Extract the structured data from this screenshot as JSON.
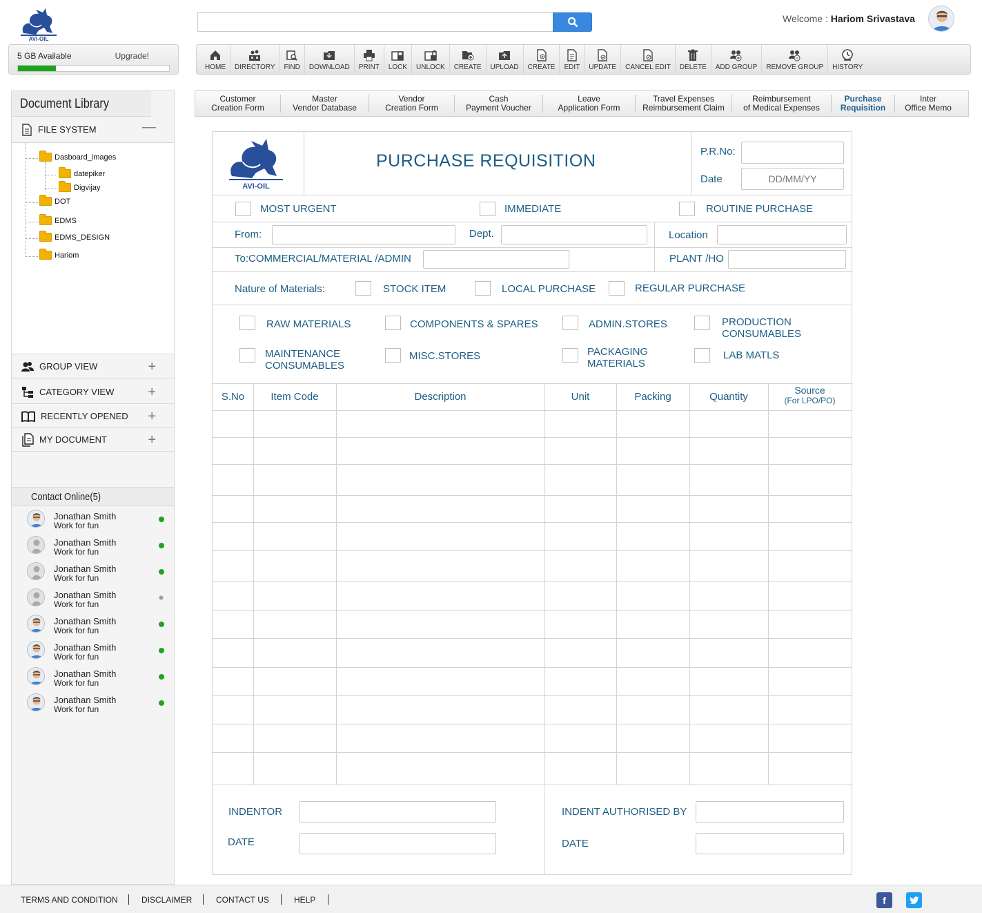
{
  "header": {
    "brand": "AVI-OIL",
    "search": {
      "placeholder": "",
      "value": ""
    },
    "welcome_prefix": "Welcome : ",
    "user_name": "Hariom Srivastava"
  },
  "storage": {
    "available": "5 GB Available",
    "upgrade": "Upgrade!",
    "used_fraction": 0.25
  },
  "toolbar": [
    {
      "label": "HOME",
      "icon": "home-icon"
    },
    {
      "label": "DIRECTORY",
      "icon": "directory-icon"
    },
    {
      "label": "FIND",
      "icon": "find-icon"
    },
    {
      "label": "DOWNLOAD",
      "icon": "download-icon"
    },
    {
      "label": "PRINT",
      "icon": "print-icon"
    },
    {
      "label": "LOCK",
      "icon": "lock-icon"
    },
    {
      "label": "UNLOCK",
      "icon": "unlock-icon"
    },
    {
      "label": "CREATE",
      "icon": "create-folder-icon"
    },
    {
      "label": "UPLOAD",
      "icon": "upload-icon"
    },
    {
      "label": "CREATE",
      "icon": "create-document-icon"
    },
    {
      "label": "EDIT",
      "icon": "edit-icon"
    },
    {
      "label": "UPDATE",
      "icon": "update-icon"
    },
    {
      "label": "CANCEL EDIT",
      "icon": "cancel-edit-icon"
    },
    {
      "label": "DELETE",
      "icon": "delete-icon"
    },
    {
      "label": "ADD GROUP",
      "icon": "add-group-icon"
    },
    {
      "label": "REMOVE GROUP",
      "icon": "remove-group-icon"
    },
    {
      "label": "HISTORY",
      "icon": "history-icon"
    }
  ],
  "sidebar": {
    "title": "Document Library",
    "file_system": "FILE SYSTEM",
    "tree": [
      "Dasboard_images",
      "datepiker",
      "Digvijay",
      "DOT",
      "EDMS",
      "EDMS_DESIGN",
      "Hariom"
    ],
    "sections": [
      {
        "label": "GROUP VIEW",
        "icon": "group-icon"
      },
      {
        "label": "CATEGORY VIEW",
        "icon": "category-icon"
      },
      {
        "label": "RECENTLY OPENED",
        "icon": "book-icon"
      },
      {
        "label": "MY DOCUMENT",
        "icon": "documents-icon"
      }
    ],
    "contacts_title": "Contact Online(5)",
    "contacts": [
      {
        "name": "Jonathan Smith",
        "status": "Work for fun",
        "photo": true,
        "online": true
      },
      {
        "name": "Jonathan Smith",
        "status": "Work for fun",
        "photo": false,
        "online": true
      },
      {
        "name": "Jonathan Smith",
        "status": "Work for fun",
        "photo": false,
        "online": true
      },
      {
        "name": "Jonathan Smith",
        "status": "Work for fun",
        "photo": false,
        "online": false
      },
      {
        "name": "Jonathan Smith",
        "status": "Work for fun",
        "photo": true,
        "online": true
      },
      {
        "name": "Jonathan Smith",
        "status": "Work for fun",
        "photo": true,
        "online": true
      },
      {
        "name": "Jonathan Smith",
        "status": "Work for fun",
        "photo": true,
        "online": true
      },
      {
        "name": "Jonathan Smith",
        "status": "Work for fun",
        "photo": true,
        "online": true
      }
    ]
  },
  "tabs": [
    {
      "l1": "Customer",
      "l2": "Creation Form"
    },
    {
      "l1": "Master",
      "l2": "Vendor Database"
    },
    {
      "l1": "Vendor",
      "l2": "Creation Form"
    },
    {
      "l1": "Cash",
      "l2": "Payment Voucher"
    },
    {
      "l1": "Leave",
      "l2": "Application Form"
    },
    {
      "l1": "Travel Expenses",
      "l2": "Reimbursement Claim"
    },
    {
      "l1": "Reimbursement",
      "l2": "of Medical Expenses"
    },
    {
      "l1": "Purchase",
      "l2": "Requisition"
    },
    {
      "l1": "Inter",
      "l2": "Office Memo"
    }
  ],
  "form": {
    "title": "PURCHASE REQUISITION",
    "pr_no_label": "P.R.No:",
    "date_label": "Date",
    "date_placeholder": "DD/MM/YY",
    "priority": [
      "MOST URGENT",
      "IMMEDIATE",
      "ROUTINE PURCHASE"
    ],
    "from_label": "From:",
    "dept_label": "Dept.",
    "location_label": "Location",
    "to_label": "To:COMMERCIAL/MATERIAL /ADMIN",
    "plant_label": "PLANT /HO",
    "nature_label": "Nature of Materials:",
    "nature": [
      "STOCK ITEM",
      "LOCAL PURCHASE",
      "REGULAR PURCHASE"
    ],
    "categories": [
      {
        "l1": "RAW MATERIALS",
        "l2": ""
      },
      {
        "l1": "COMPONENTS & SPARES",
        "l2": ""
      },
      {
        "l1": "ADMIN.STORES",
        "l2": ""
      },
      {
        "l1": "PRODUCTION",
        "l2": "CONSUMABLES"
      },
      {
        "l1": "MAINTENANCE",
        "l2": "CONSUMABLES"
      },
      {
        "l1": "MISC.STORES",
        "l2": ""
      },
      {
        "l1": "PACKAGING",
        "l2": "MATERIALS"
      },
      {
        "l1": "LAB MATLS",
        "l2": ""
      }
    ],
    "columns": [
      "S.No",
      "Item Code",
      "Description",
      "Unit",
      "Packing",
      "Quantity",
      "Source"
    ],
    "source_sub": "(For LPO/PO)",
    "indentor_label": "INDENTOR",
    "authorised_label": "INDENT AUTHORISED BY",
    "date2_label": "DATE"
  },
  "footer": {
    "links": [
      "TERMS AND CONDITION",
      "DISCLAIMER",
      "CONTACT US",
      "HELP"
    ],
    "social": [
      "facebook-icon",
      "twitter-icon"
    ]
  },
  "colors": {
    "accent": "#3a87e0",
    "form_text": "#1d5d85",
    "online": "#1ea51e",
    "offline": "#9a9a9a"
  }
}
